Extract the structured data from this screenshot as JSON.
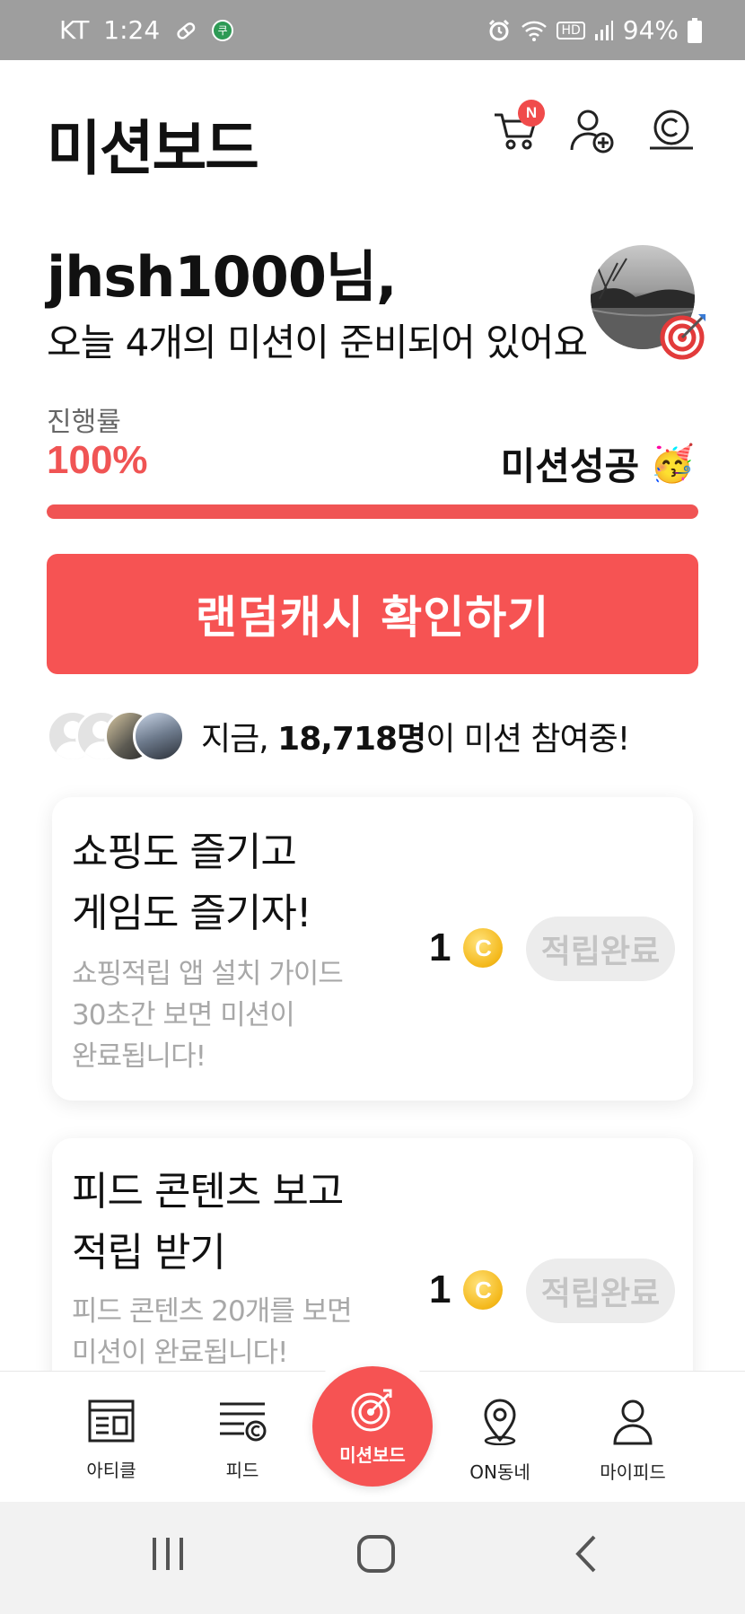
{
  "status_bar": {
    "carrier": "KT",
    "time": "1:24",
    "app_badge": "쿠",
    "hd_label": "HD",
    "battery": "94%"
  },
  "header": {
    "title": "미션보드",
    "cart_badge": "N"
  },
  "greeting": {
    "name_line": "jhsh1000님,",
    "message": "오늘 4개의 미션이 준비되어 있어요"
  },
  "progress": {
    "label": "진행률",
    "value_text": "100%",
    "value": 1.0,
    "status": "미션성공",
    "status_emoji": "🥳"
  },
  "cta": {
    "label": "랜덤캐시 확인하기"
  },
  "participants": {
    "prefix": "지금, ",
    "count": "18,718명",
    "suffix": "이 미션 참여중!"
  },
  "missions": [
    {
      "title_lines": [
        "쇼핑도 즐기고",
        "게임도 즐기자!"
      ],
      "desc_lines": [
        "쇼핑적립 앱 설치 가이드",
        "30초간 보면 미션이",
        "완료됩니다!"
      ],
      "reward": "1",
      "coin_symbol": "C",
      "status": "적립완료"
    },
    {
      "title_lines": [
        "피드 콘텐츠 보고",
        "적립 받기"
      ],
      "desc_lines": [
        "피드 콘텐츠 20개를 보면",
        "미션이 완료됩니다!"
      ],
      "reward": "1",
      "coin_symbol": "C",
      "status": "적립완료"
    }
  ],
  "bottom_nav": {
    "items": [
      {
        "label": "아티클",
        "icon": "article-icon"
      },
      {
        "label": "피드",
        "icon": "feed-icon"
      },
      {
        "label": "미션보드",
        "icon": "target-icon"
      },
      {
        "label": "ON동네",
        "icon": "location-pin-icon"
      },
      {
        "label": "마이피드",
        "icon": "person-icon"
      }
    ]
  },
  "colors": {
    "accent": "#f65353",
    "progress": "#f05454",
    "muted_text": "#a8a8a8",
    "done_pill_bg": "#ececec"
  }
}
